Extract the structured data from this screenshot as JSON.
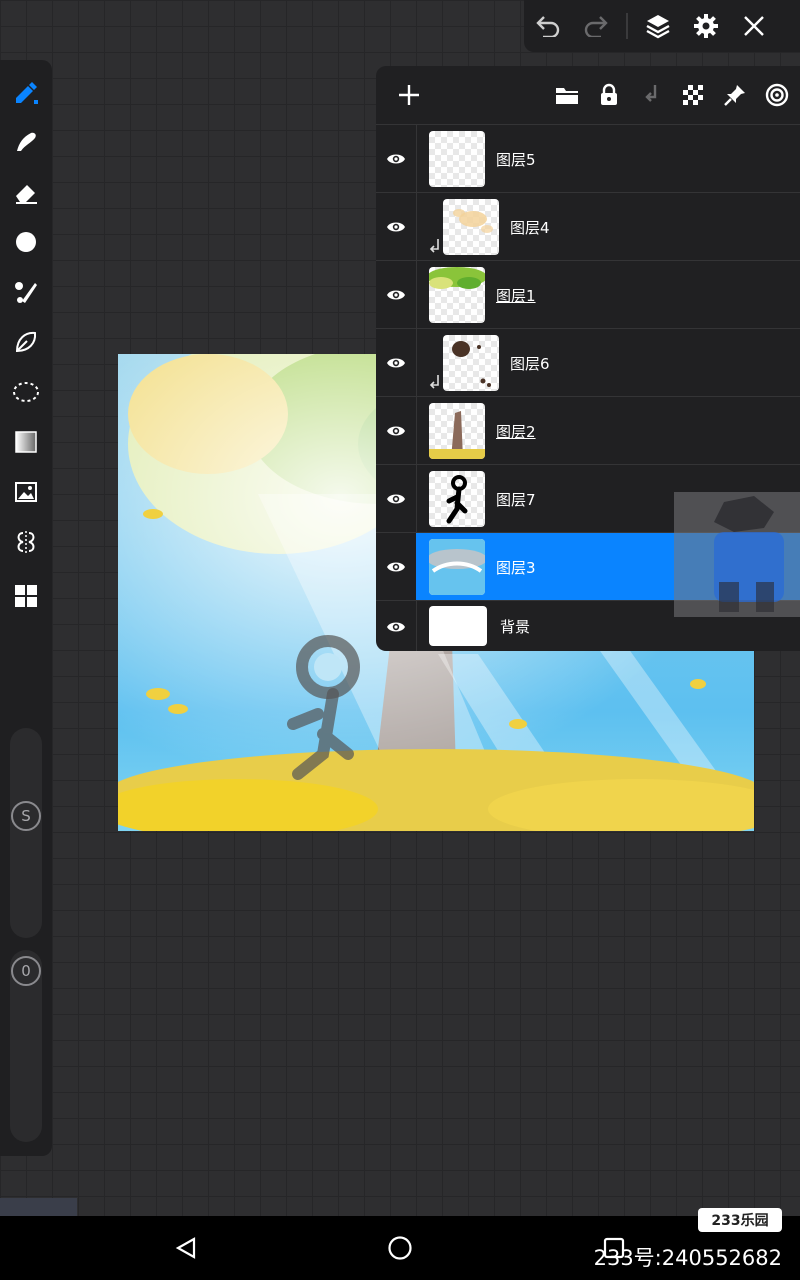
{
  "topbar": {
    "icons": [
      "undo-icon",
      "redo-icon",
      "layers-icon",
      "gear-icon",
      "close-icon"
    ]
  },
  "toolbar": {
    "tools": [
      "pen-icon",
      "smudge-icon",
      "eraser-icon",
      "fill-icon",
      "brush-icon",
      "lasso-icon",
      "selection-icon",
      "gradient-icon",
      "image-icon",
      "symmetry-icon",
      "more-icon"
    ],
    "size_label": "S",
    "opacity_label": "0"
  },
  "layers_panel": {
    "header_icons": [
      "add-layer-icon",
      "folder-icon",
      "lock-icon",
      "clip-icon",
      "transparency-icon",
      "pin-icon",
      "target-icon"
    ],
    "layers": [
      {
        "name": "图层5",
        "clipped": false,
        "selected": false
      },
      {
        "name": "图层4",
        "clipped": true,
        "selected": false
      },
      {
        "name": "图层1",
        "clipped": false,
        "selected": false
      },
      {
        "name": "图层6",
        "clipped": true,
        "selected": false
      },
      {
        "name": "图层2",
        "clipped": false,
        "selected": false
      },
      {
        "name": "图层7",
        "clipped": false,
        "selected": false
      },
      {
        "name": "图层3",
        "clipped": false,
        "selected": true
      },
      {
        "name": "背景",
        "clipped": false,
        "selected": false
      }
    ]
  },
  "colors": {
    "accent": "#0a84ff",
    "panel_bg": "#202022",
    "toolbar_bg": "#1f1f21"
  },
  "watermark": {
    "badge": "233乐园",
    "text": "233号:240552682"
  }
}
